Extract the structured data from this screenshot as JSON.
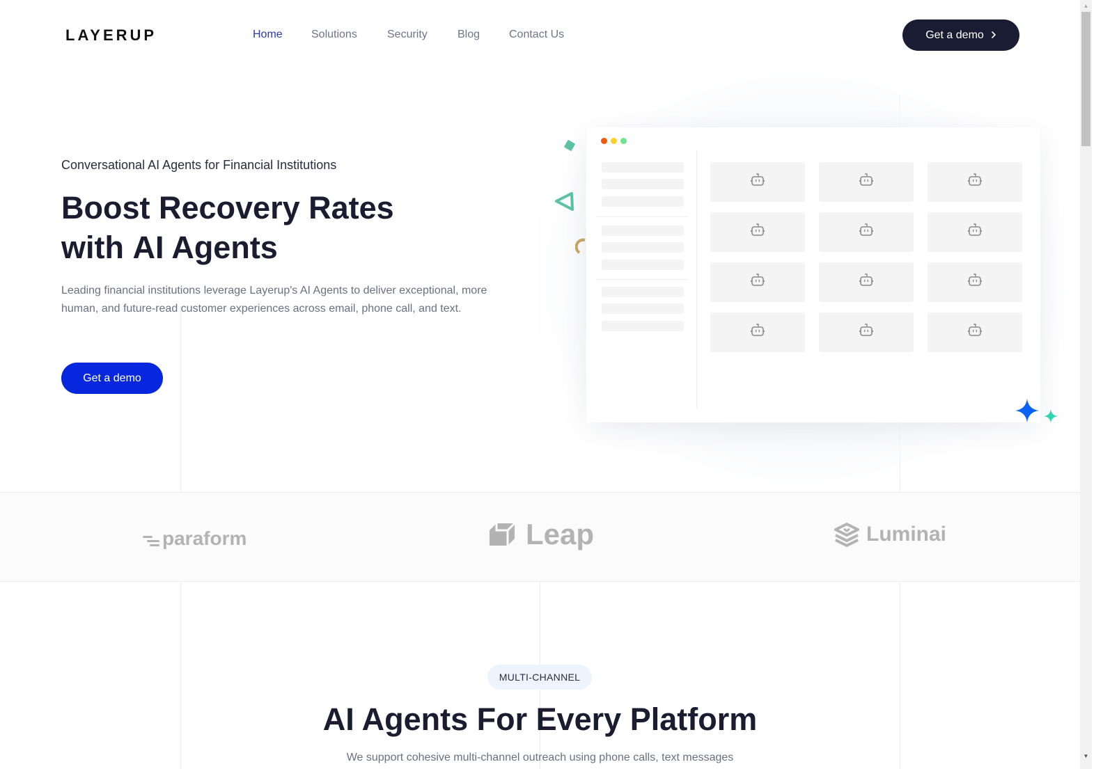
{
  "nav": {
    "logo": "LAYERUP",
    "links": [
      {
        "label": "Home",
        "active": true
      },
      {
        "label": "Solutions",
        "active": false
      },
      {
        "label": "Security",
        "active": false
      },
      {
        "label": "Blog",
        "active": false
      },
      {
        "label": "Contact Us",
        "active": false
      }
    ],
    "cta_label": "Get a demo",
    "cta_icon": "chevron-right-icon"
  },
  "hero": {
    "eyebrow": "Conversational AI Agents for Financial Institutions",
    "title_line1": "Boost Recovery Rates",
    "title_line2_prefix": "with ",
    "title_line2_highlight": "AI Agents",
    "lead": "Leading financial institutions leverage Layerup's AI Agents to deliver exceptional, more human, and future-read customer experiences across email, phone call, and text.",
    "cta_label": "Get a demo",
    "mockup": {
      "window_dots": [
        "#f0580a",
        "#fdd126",
        "#6fe48c"
      ],
      "tile_icon": "robot-icon",
      "tile_count": 12
    }
  },
  "partners": [
    {
      "name": "paraform",
      "icon": "paraform-logo-icon"
    },
    {
      "name": "Leap",
      "icon": "leap-logo-icon"
    },
    {
      "name": "Luminai",
      "icon": "luminai-logo-icon"
    }
  ],
  "section2": {
    "pill": "MULTI-CHANNEL",
    "title": "AI Agents For Every Platform",
    "subtitle": "We support cohesive multi-channel outreach using phone calls, text messages"
  },
  "colors": {
    "brand_dark": "#1a1c33",
    "brand_blue": "#0627dd",
    "nav_active": "#2a3bb8",
    "highlight": "#a9f7ef"
  }
}
